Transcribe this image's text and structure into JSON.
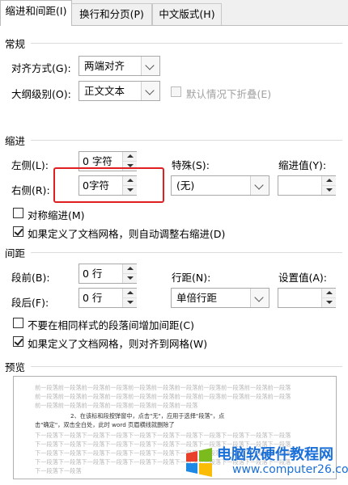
{
  "tabs": [
    {
      "label": "缩进和间距(I)"
    },
    {
      "label": "换行和分页(P)"
    },
    {
      "label": "中文版式(H)"
    }
  ],
  "general": {
    "heading": "常规",
    "alignment_label": "对齐方式(G):",
    "alignment_value": "两端对齐",
    "outline_label": "大纲级别(O):",
    "outline_value": "正文文本",
    "collapse_label": "默认情况下折叠(E)"
  },
  "indent": {
    "heading": "缩进",
    "left_label": "左侧(L):",
    "left_value": "0 字符",
    "right_label": "右侧(R):",
    "right_value": "0字符",
    "special_label": "特殊(S):",
    "special_value": "(无)",
    "indent_by_label": "缩进值(Y):",
    "indent_by_value": "",
    "mirror_label": "对称缩进(M)",
    "mirror_checked": false,
    "auto_adjust_label": "如果定义了文档网格，则自动调整右缩进(D)",
    "auto_adjust_checked": true
  },
  "spacing": {
    "heading": "间距",
    "before_label": "段前(B):",
    "before_value": "0 行",
    "after_label": "段后(F):",
    "after_value": "0 行",
    "line_spacing_label": "行距(N):",
    "line_spacing_value": "单倍行距",
    "at_label": "设置值(A):",
    "at_value": "",
    "no_space_label": "不要在相同样式的段落间增加间距(C)",
    "no_space_checked": false,
    "snap_grid_label": "如果定义了文档网格，则对齐到网格(W)",
    "snap_grid_checked": true
  },
  "preview": {
    "heading": "预览",
    "lines": [
      "前一段落前一段落前一段落前一段落前一段落前一段落前一段落前一段落前一段落前一段落前一段落",
      "前一段落前一段落前一段落前一段落前一段落前一段落前一段落前一段落前一段落前一段落前一段落",
      "前一段落前一段落前一段落前一段落前一段落前一段落前一段落"
    ],
    "sample_lines": [
      "2、在该标和段按弹窗中，点击\"无\"，应用于选择\"段落\"，点",
      "击\"确定\"，双击全白处，此时 word 页眉横线就删除了"
    ],
    "after_lines": [
      "下一段落下一段落下一段落下一段落下一段落下一段落下一段落下一段落下一段落下一段落下一段落",
      "下一段落下一段落下一段落下一段落下一段落下一段落下一段落下一段落下一段落下一段落下一段落",
      "下一段落下一段落下一段落下一段落下一段落下一段落下一段落下一段落下一段落下一段落下一段落",
      "下一段落下一段落下一段落下一段落下一段落下一段落下一段落下一段落下一段落下一段落下一段落",
      "下一段落下一段落"
    ]
  },
  "watermark": {
    "title": "电脑软硬件教程网",
    "url": "www.computer26.com"
  },
  "colors": {
    "highlight": "#e02020",
    "watermark": "#1a6fd8"
  }
}
